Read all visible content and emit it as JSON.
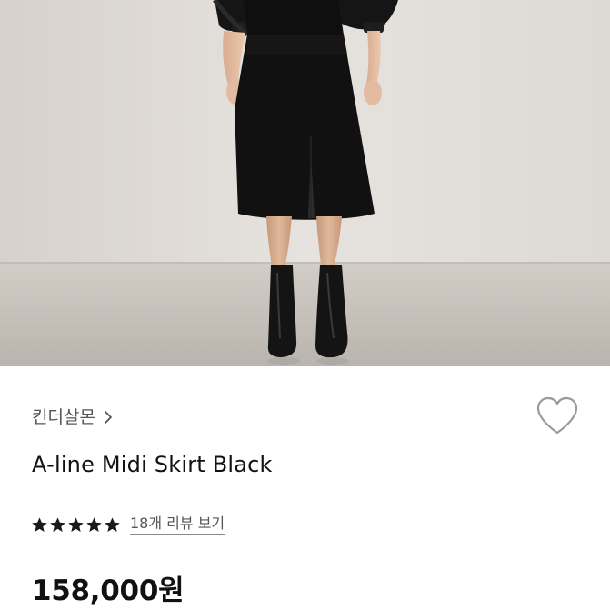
{
  "product": {
    "brand": "킨더살몬",
    "name": "A-line Midi Skirt Black",
    "rating_stars": 5,
    "rating_max": 5,
    "review_link": "18개 리뷰 보기",
    "price": "158,000원"
  },
  "icons": {
    "brand": "chevron-right-icon",
    "wishlist": "heart-outline-icon",
    "rating": "star-icon"
  },
  "colors": {
    "star": "#1a1a1a",
    "text_primary": "#111111",
    "text_secondary": "#555555",
    "heart_stroke": "#9a9a9a"
  }
}
